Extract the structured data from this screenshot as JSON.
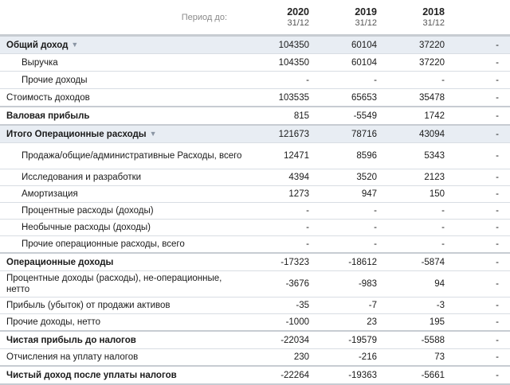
{
  "header": {
    "period_label": "Период до:",
    "columns": [
      {
        "year": "2020",
        "date": "31/12"
      },
      {
        "year": "2019",
        "date": "31/12"
      },
      {
        "year": "2018",
        "date": "31/12"
      }
    ]
  },
  "rows": [
    {
      "label": "Общий доход",
      "v2020": "104350",
      "v2019": "60104",
      "v2018": "37220",
      "extra": "-"
    },
    {
      "label": "Выручка",
      "v2020": "104350",
      "v2019": "60104",
      "v2018": "37220",
      "extra": "-"
    },
    {
      "label": "Прочие доходы",
      "v2020": "-",
      "v2019": "-",
      "v2018": "-",
      "extra": "-"
    },
    {
      "label": "Стоимость доходов",
      "v2020": "103535",
      "v2019": "65653",
      "v2018": "35478",
      "extra": "-"
    },
    {
      "label": "Валовая прибыль",
      "v2020": "815",
      "v2019": "-5549",
      "v2018": "1742",
      "extra": "-"
    },
    {
      "label": "Итого Операционные расходы",
      "v2020": "121673",
      "v2019": "78716",
      "v2018": "43094",
      "extra": "-"
    },
    {
      "label": "Продажа/общие/административные Расходы, всего",
      "v2020": "12471",
      "v2019": "8596",
      "v2018": "5343",
      "extra": "-"
    },
    {
      "label": "Исследования и разработки",
      "v2020": "4394",
      "v2019": "3520",
      "v2018": "2123",
      "extra": "-"
    },
    {
      "label": "Амортизация",
      "v2020": "1273",
      "v2019": "947",
      "v2018": "150",
      "extra": "-"
    },
    {
      "label": "Процентные расходы (доходы)",
      "v2020": "-",
      "v2019": "-",
      "v2018": "-",
      "extra": "-"
    },
    {
      "label": "Необычные расходы (доходы)",
      "v2020": "-",
      "v2019": "-",
      "v2018": "-",
      "extra": "-"
    },
    {
      "label": "Прочие операционные расходы, всего",
      "v2020": "-",
      "v2019": "-",
      "v2018": "-",
      "extra": "-"
    },
    {
      "label": "Операционные доходы",
      "v2020": "-17323",
      "v2019": "-18612",
      "v2018": "-5874",
      "extra": "-"
    },
    {
      "label": "Процентные доходы (расходы), не-операционные, нетто",
      "v2020": "-3676",
      "v2019": "-983",
      "v2018": "94",
      "extra": "-"
    },
    {
      "label": "Прибыль (убыток) от продажи активов",
      "v2020": "-35",
      "v2019": "-7",
      "v2018": "-3",
      "extra": "-"
    },
    {
      "label": "Прочие доходы, нетто",
      "v2020": "-1000",
      "v2019": "23",
      "v2018": "195",
      "extra": "-"
    },
    {
      "label": "Чистая прибыль до налогов",
      "v2020": "-22034",
      "v2019": "-19579",
      "v2018": "-5588",
      "extra": "-"
    },
    {
      "label": "Отчисления на уплату налогов",
      "v2020": "230",
      "v2019": "-216",
      "v2018": "73",
      "extra": "-"
    },
    {
      "label": "Чистый доход после уплаты налогов",
      "v2020": "-22264",
      "v2019": "-19363",
      "v2018": "-5661",
      "extra": "-"
    }
  ]
}
